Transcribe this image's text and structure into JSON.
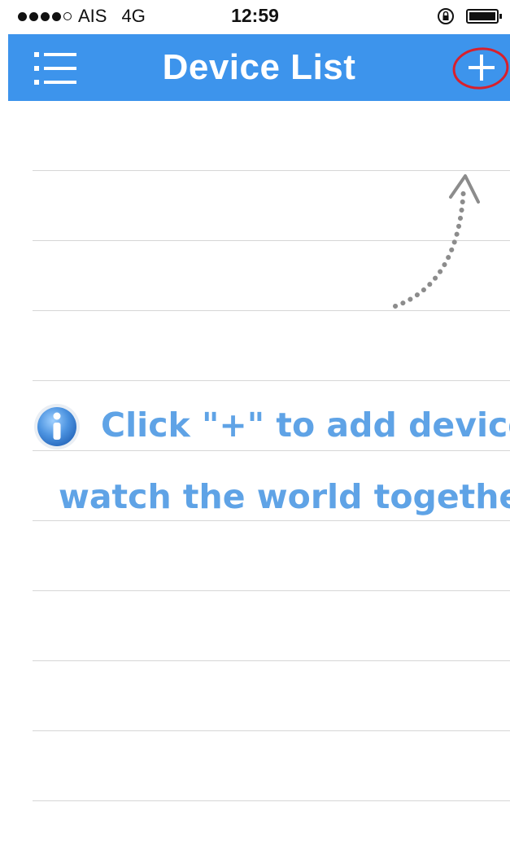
{
  "status_bar": {
    "carrier": "AIS",
    "network": "4G",
    "time": "12:59",
    "signal_bars_filled": 4,
    "signal_bars_total": 5
  },
  "nav_bar": {
    "title": "Device List",
    "menu_icon": "list-menu-icon",
    "add_icon": "plus-icon",
    "background_color": "#3d94ec"
  },
  "empty_state": {
    "line1": "Click \"+\" to add device",
    "line2": "watch the world together",
    "icon": "info-icon",
    "text_color": "#5fa3e6"
  }
}
